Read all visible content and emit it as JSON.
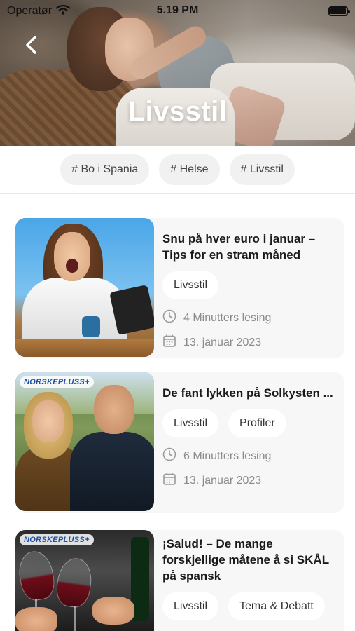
{
  "status_bar": {
    "carrier": "Operatør",
    "time": "5.19 PM"
  },
  "header": {
    "title": "Livsstil",
    "back_icon": "chevron-left-icon"
  },
  "tags": [
    {
      "label": "# Bo i Spania"
    },
    {
      "label": "# Helse"
    },
    {
      "label": "# Livsstil"
    }
  ],
  "articles": [
    {
      "title": "Snu på hver euro i januar – Tips for en stram måned",
      "categories": [
        "Livsstil"
      ],
      "read_time": "4 Minutters lesing",
      "date": "13. januar 2023",
      "badge": ""
    },
    {
      "title": "De fant lykken på Solkysten ...",
      "categories": [
        "Livsstil",
        "Profiler"
      ],
      "read_time": "6 Minutters lesing",
      "date": "13. januar 2023",
      "badge": "NORSKEPLUSS+"
    },
    {
      "title": "¡Salud! – De mange forskjellige måtene å si SKÅL på spansk",
      "categories": [
        "Livsstil",
        "Tema & Debatt"
      ],
      "badge": "NORSKEPLUSS+"
    }
  ],
  "colors": {
    "card_bg": "#f7f7f7",
    "chip_bg": "#f1f1f1",
    "meta_text": "#8a8a8a",
    "badge_blue": "#1d4fa3"
  }
}
